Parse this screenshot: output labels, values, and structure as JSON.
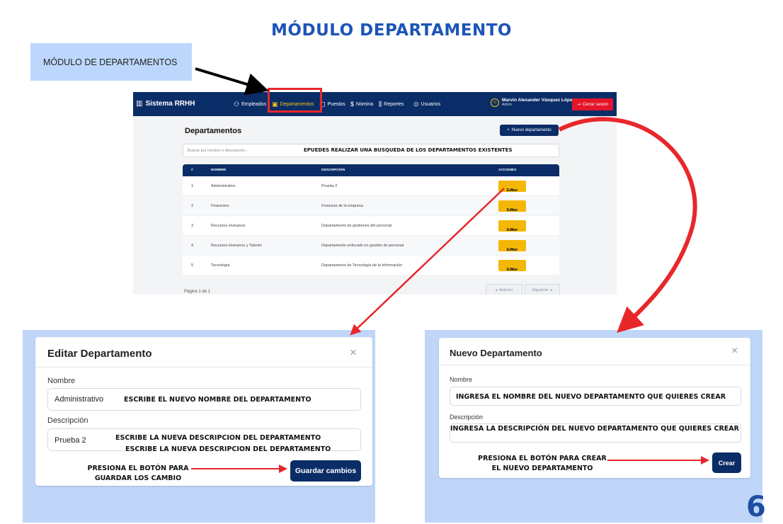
{
  "doc": {
    "title": "MÓDULO DEPARTAMENTO",
    "label_box": "MÓDULO DE DEPARTAMENTOS",
    "page_number": "6"
  },
  "app": {
    "brand": "Sistema RRHH",
    "nav": [
      {
        "label": "Empleados",
        "icon": "users-icon"
      },
      {
        "label": "Departamentos",
        "icon": "building-icon",
        "active": true
      },
      {
        "label": "Puestos",
        "icon": "briefcase-icon"
      },
      {
        "label": "Nómina",
        "icon": "dollar-icon"
      },
      {
        "label": "Reportes",
        "icon": "bar-chart-icon"
      },
      {
        "label": "Usuarios",
        "icon": "user-check-icon"
      }
    ],
    "user_name": "Marvin Alexander Vásquez López",
    "user_role": "Admin",
    "logout": "Cerrar sesión",
    "page_title": "Departamentos",
    "new_button": "Nuevo departamento",
    "search_placeholder": "Buscar por nombre o descripción...",
    "search_note": "EPUEDES REALIZAR UNA BUSQUEDA DE LOS DEPARTAMENTOS EXISTENTES",
    "columns": [
      "#",
      "NOMBRE",
      "DESCRIPCIÓN",
      "ACCIONES"
    ],
    "rows": [
      {
        "id": "1",
        "name": "Administrativo",
        "desc": "Prueba 2"
      },
      {
        "id": "2",
        "name": "Financiero",
        "desc": "Finanzas de la empresa"
      },
      {
        "id": "3",
        "name": "Recursos Humanos",
        "desc": "Departamento de gestiones del personal"
      },
      {
        "id": "4",
        "name": "Recursos Humanos y Talento",
        "desc": "Departamento enfocado en gestión de personal"
      },
      {
        "id": "5",
        "name": "Tecnología",
        "desc": "Departamento de Tecnología de la Información"
      }
    ],
    "edit_label": "Editar",
    "pager_text": "Página 1 de 1",
    "prev": "Anterior",
    "next": "Siguiente"
  },
  "edit_modal": {
    "title": "Editar Departamento",
    "close": "×",
    "name_label": "Nombre",
    "name_value": "Administrativo",
    "name_note": "ESCRIBE EL NUEVO NOMBRE DEL DEPARTAMENTO",
    "desc_label": "Descripción",
    "desc_value": "Prueba 2",
    "desc_note_1": "ESCRIBE LA NUEVA DESCRIPCION DEL DEPARTAMENTO",
    "desc_note_2": "ESCRIBE LA NUEVA DESCRIPCION DEL DEPARTAMENTO",
    "save_button": "Guardar cambios",
    "caption_1": "PRESIONA EL BOTÓN PARA",
    "caption_2": "GUARDAR LOS CAMBIO"
  },
  "new_modal": {
    "title": "Nuevo Departamento",
    "close": "×",
    "name_label": "Nombre",
    "name_note": "INGRESA EL NOMBRE DEL NUEVO DEPARTAMENTO QUE QUIERES CREAR",
    "desc_label": "Descripción",
    "desc_note": "INGRESA LA DESCRIPCIÓN DEL NUEVO DEPARTAMENTO QUE QUIERES CREAR",
    "create_button": "Crear",
    "caption_1": "PRESIONA EL BOTÓN PARA CREAR",
    "caption_2": "EL NUEVO DEPARTAMENTO"
  },
  "colors": {
    "navy": "#0b2d67",
    "accent_yellow": "#f4b705",
    "annotation_red": "#e8272b",
    "panel_blue": "#bfd6f9",
    "title_blue": "#1d54b8"
  }
}
